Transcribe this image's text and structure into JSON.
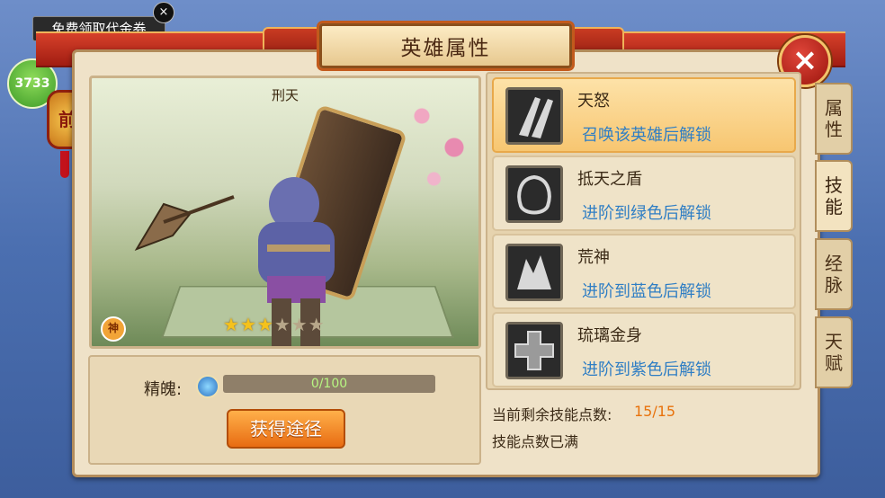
{
  "promo": {
    "label": "免费领取代金券",
    "close": "×"
  },
  "top_left": {
    "gold_count": "3733",
    "front_badge": "前"
  },
  "title": "英雄属性",
  "close_button": "×",
  "hero": {
    "name": "刑天",
    "stars_filled": 3,
    "stars_total": 6,
    "god_badge": "神"
  },
  "essence": {
    "label": "精魄:",
    "progress_text": "0/100",
    "progress_fraction": 0
  },
  "obtain_button": "获得途径",
  "skills": [
    {
      "name": "天怒",
      "note": "召唤该英雄后解锁",
      "active": true
    },
    {
      "name": "抵天之盾",
      "note": "进阶到绿色后解锁",
      "active": false
    },
    {
      "name": "荒神",
      "note": "进阶到蓝色后解锁",
      "active": false
    },
    {
      "name": "琉璃金身",
      "note": "进阶到紫色后解锁",
      "active": false
    }
  ],
  "skill_points": {
    "label": "当前剩余技能点数:",
    "value": "15/15",
    "status": "技能点数已满"
  },
  "side_tabs": [
    {
      "chars": [
        "属",
        "性"
      ]
    },
    {
      "chars": [
        "技",
        "能"
      ]
    },
    {
      "chars": [
        "经",
        "脉"
      ]
    },
    {
      "chars": [
        "天",
        "赋"
      ]
    }
  ],
  "colors": {
    "frame_bg": "#efe2c8",
    "title_red": "#c93b22",
    "accent_orange": "#e86c12",
    "note_blue": "#2f7ec4",
    "value_orange": "#e8720c"
  }
}
